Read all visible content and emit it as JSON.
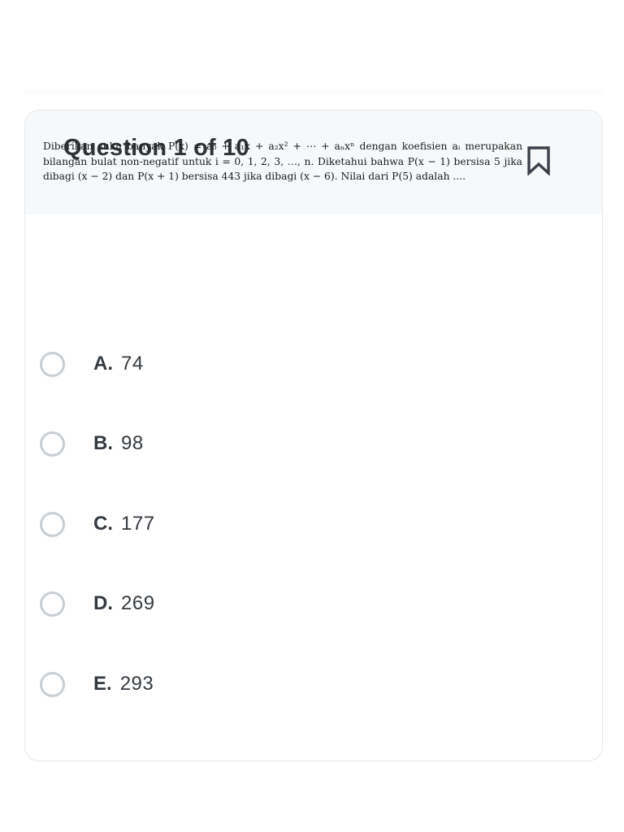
{
  "header": {
    "title": "Question 1 of 10",
    "bookmark_icon": "bookmark-icon"
  },
  "question": {
    "text": "Diberikan suku banyak P(x) = a₀ + a₁x + a₂x² + ⋯ + aₙxⁿ dengan koefisien aᵢ merupakan bilangan bulat non-negatif untuk i = 0, 1, 2, 3, …, n. Diketahui bahwa P(x − 1) bersisa 5 jika dibagi (x − 2) dan P(x + 1) bersisa 443 jika dibagi (x − 6). Nilai dari P(5) adalah ...."
  },
  "options": [
    {
      "letter": "A.",
      "value": "74"
    },
    {
      "letter": "B.",
      "value": "98"
    },
    {
      "letter": "C.",
      "value": "177"
    },
    {
      "letter": "D.",
      "value": "269"
    },
    {
      "letter": "E.",
      "value": "293"
    }
  ],
  "colors": {
    "header_bg": "#f6f8fa",
    "radio_border": "#c9ced3",
    "text_dark": "#343a40"
  }
}
